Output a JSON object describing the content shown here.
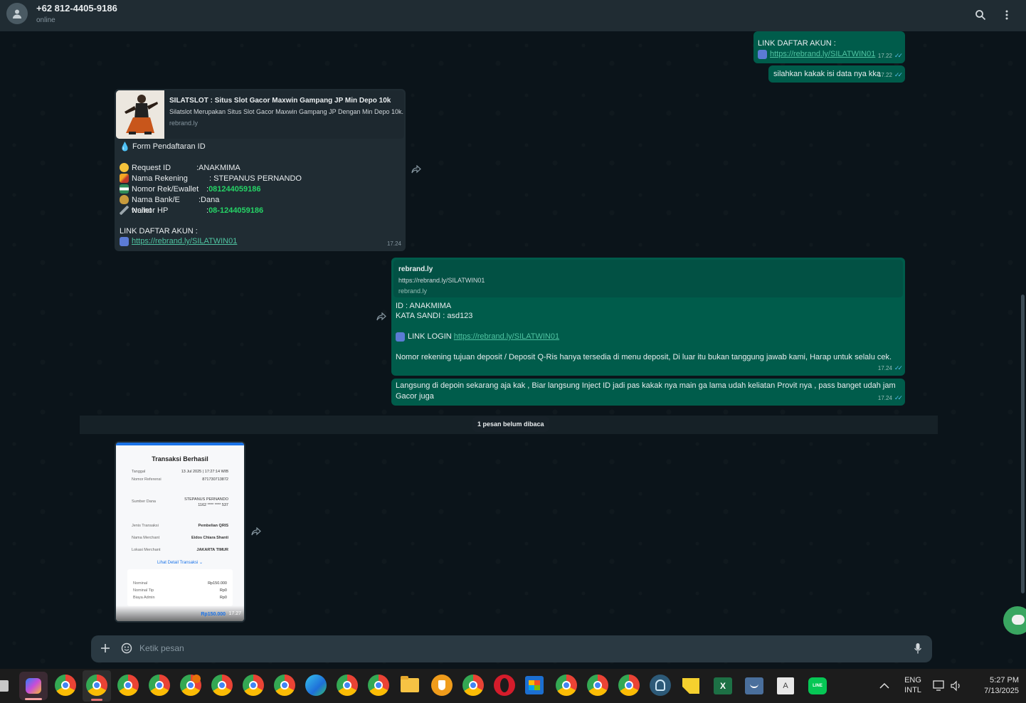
{
  "header": {
    "contact_name": "+62 812-4405-9186",
    "status": "online",
    "icons": [
      "user-avatar-icon",
      "search-icon",
      "more-vertical-icon"
    ]
  },
  "messages": {
    "m1": {
      "title": "LINK DAFTAR AKUN :",
      "url": "https://rebrand.ly/SILATWIN01",
      "time": "17.22"
    },
    "m2": {
      "text": "silahkan kakak isi data nya kka",
      "time": "17.22"
    },
    "m3": {
      "preview_title": "SILATSLOT : Situs Slot Gacor Maxwin Gampang JP Min Depo 10k",
      "preview_desc": "Silatslot Merupakan Situs Slot Gacor Maxwin Gampang JP Dengan Min Depo 10k.",
      "preview_domain": "rebrand.ly",
      "form_title": "Form Pendaftaran ID",
      "rows": [
        {
          "label": "Request ID",
          "value": ":ANAKMIMA"
        },
        {
          "label": "Nama Rekening",
          "value": ": STEPANUS PERNANDO"
        },
        {
          "label": "Nomor Rek/Ewallet",
          "value": ":",
          "green": "081244059186"
        },
        {
          "label": "Nama Bank/E wallet",
          "value": ":Dana"
        },
        {
          "label": "Nomor HP",
          "value": ":",
          "green": "08-1244059186"
        }
      ],
      "link_title": "LINK DAFTAR AKUN :",
      "url": "https://rebrand.ly/SILATWIN01",
      "time": "17.24"
    },
    "m4": {
      "preview_title": "rebrand.ly",
      "preview_url": "https://rebrand.ly/SILATWIN01",
      "preview_domain": "rebrand.ly",
      "id_line": "ID : ANAKMIMA",
      "pass_line": "KATA SANDI : asd123",
      "login_label": "LINK LOGIN",
      "url": "https://rebrand.ly/SILATWIN01",
      "note": "Nomor rekening tujuan deposit / Deposit Q-Ris hanya tersedia di menu deposit, Di luar itu bukan tanggung jawab kami, Harap untuk selalu cek.",
      "time": "17.24"
    },
    "m5": {
      "text": "Langsung di depoin sekarang aja kak , Biar langsung Inject ID jadi pas kakak nya main ga lama udah keliatan Provit nya , pass banget udah jam Gacor juga",
      "time": "17.24"
    },
    "unread_label": "1 pesan belum dibaca",
    "receipt": {
      "title": "Transaksi Berhasil",
      "rows": [
        {
          "label": "Tanggal",
          "value": "13 Jul 2025 | 17:27:14 WIB"
        },
        {
          "label": "Nomor Referensi",
          "value": "871730713872"
        },
        {
          "label": "Sumber Dana",
          "value": "STEPANUS PERNANDO 1162 **** **** 537"
        },
        {
          "label": "Jenis Transaksi",
          "value": "Pembelian QRIS"
        },
        {
          "label": "Nama Merchant",
          "value": "Eidos Chiara Shanti"
        },
        {
          "label": "Lokasi Merchant",
          "value": "JAKARTA TIMUR"
        }
      ],
      "detail_link": "Lihat Detail Transaksi",
      "amounts": [
        {
          "label": "Nominal",
          "value": "Rp150.000"
        },
        {
          "label": "Nominal Tip",
          "value": "Rp0"
        },
        {
          "label": "Biaya Admin",
          "value": "Rp0"
        }
      ],
      "total_partial": "Rp150.000",
      "time": "17.27"
    }
  },
  "composer": {
    "placeholder": "Ketik pesan",
    "icons": [
      "plus-icon",
      "emoji-icon",
      "microphone-icon"
    ]
  },
  "taskbar": {
    "lang_top": "ENG",
    "lang_bottom": "INTL",
    "clock_time": "5:27 PM",
    "clock_date": "7/13/2025"
  },
  "colors": {
    "header_bg": "#202c33",
    "chat_bg": "#0b141a",
    "outgoing_bubble": "#005c4b",
    "incoming_bubble": "#202c33",
    "accent_green": "#25d366",
    "tick_blue": "#53bdeb"
  }
}
